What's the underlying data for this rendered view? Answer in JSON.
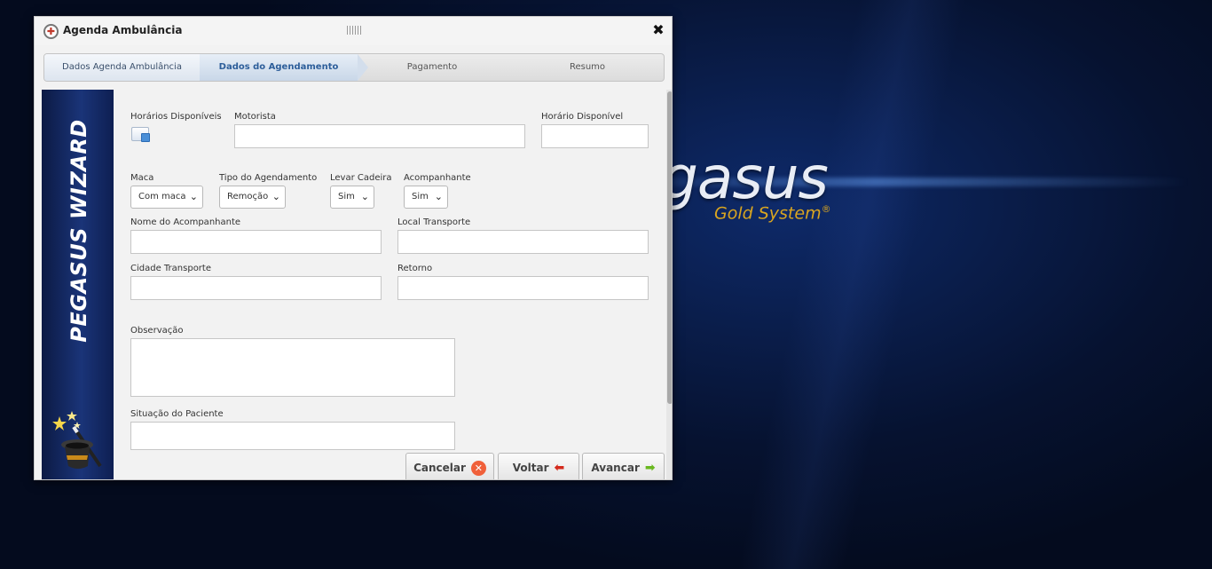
{
  "background": {
    "logo_text": "gasus",
    "logo_sub": "Gold System",
    "logo_reg": "®"
  },
  "dialog": {
    "title": "Agenda Ambulância",
    "app_icon": "ambulance-icon",
    "close_icon": "close-icon"
  },
  "steps": [
    {
      "label": "Dados Agenda Ambulância",
      "state": "done"
    },
    {
      "label": "Dados do Agendamento",
      "state": "active"
    },
    {
      "label": "Pagamento",
      "state": "pending"
    },
    {
      "label": "Resumo",
      "state": "pending"
    }
  ],
  "side_banner": {
    "text": "PEGASUS WIZARD",
    "icon": "magic-hat-icon"
  },
  "form": {
    "horarios_disponiveis": {
      "label": "Horários Disponíveis",
      "icon": "calendar-search-icon"
    },
    "motorista": {
      "label": "Motorista",
      "value": ""
    },
    "horario_disponivel": {
      "label": "Horário Disponível",
      "value": ""
    },
    "maca": {
      "label": "Maca",
      "value": "Com maca"
    },
    "tipo_agendamento": {
      "label": "Tipo do Agendamento",
      "value": "Remoção"
    },
    "levar_cadeira": {
      "label": "Levar Cadeira",
      "value": "Sim"
    },
    "acompanhante": {
      "label": "Acompanhante",
      "value": "Sim"
    },
    "nome_acompanhante": {
      "label": "Nome do Acompanhante",
      "value": ""
    },
    "local_transporte": {
      "label": "Local Transporte",
      "value": ""
    },
    "cidade_transporte": {
      "label": "Cidade Transporte",
      "value": ""
    },
    "retorno": {
      "label": "Retorno",
      "value": ""
    },
    "observacao": {
      "label": "Observação",
      "value": ""
    },
    "situacao_paciente": {
      "label": "Situação do Paciente",
      "value": ""
    }
  },
  "buttons": {
    "cancel": "Cancelar",
    "back": "Voltar",
    "next": "Avancar"
  },
  "colors": {
    "active_step": "#2d5e9a",
    "cancel_icon": "#f0603a",
    "back_icon": "#d42a1c",
    "next_icon": "#6ab820",
    "brand_gold": "#d9a520"
  }
}
